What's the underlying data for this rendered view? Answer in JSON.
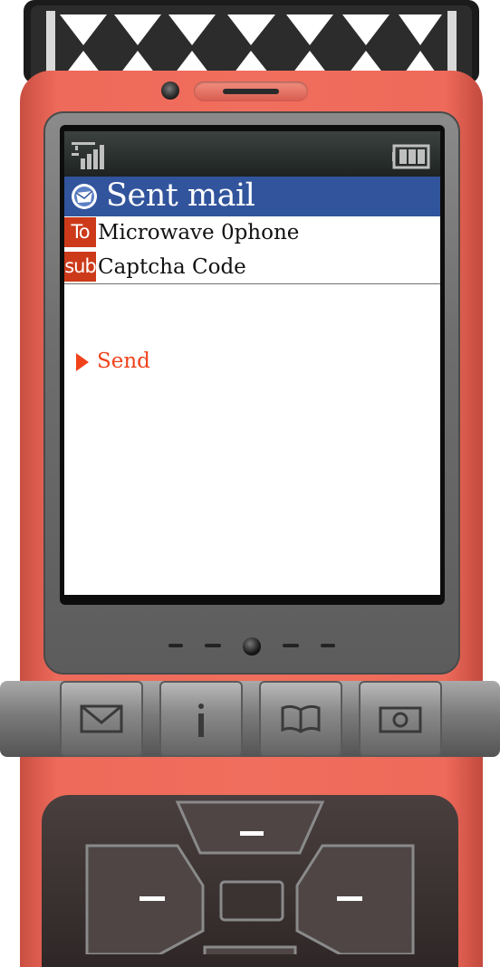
{
  "status_bar": {
    "signal_icon": "signal-strength-icon",
    "battery_icon": "battery-icon"
  },
  "title_bar": {
    "icon": "mail-icon",
    "title": "Sent mail"
  },
  "fields": {
    "to": {
      "tag": "To",
      "value": "Microwave 0phone"
    },
    "subject": {
      "tag": "sub",
      "value": "Captcha Code"
    }
  },
  "menu": {
    "selected_item": "Send"
  },
  "hardware_keys": [
    {
      "name": "mail-key",
      "icon": "envelope-icon"
    },
    {
      "name": "info-key",
      "icon": "info-icon"
    },
    {
      "name": "book-key",
      "icon": "open-book-icon"
    },
    {
      "name": "camera-key",
      "icon": "camera-icon"
    }
  ],
  "colors": {
    "phone_body": "#f06e5d",
    "title_bar": "#31549c",
    "tag_bg": "#cc3a1a",
    "menu_accent": "#f0421b"
  }
}
